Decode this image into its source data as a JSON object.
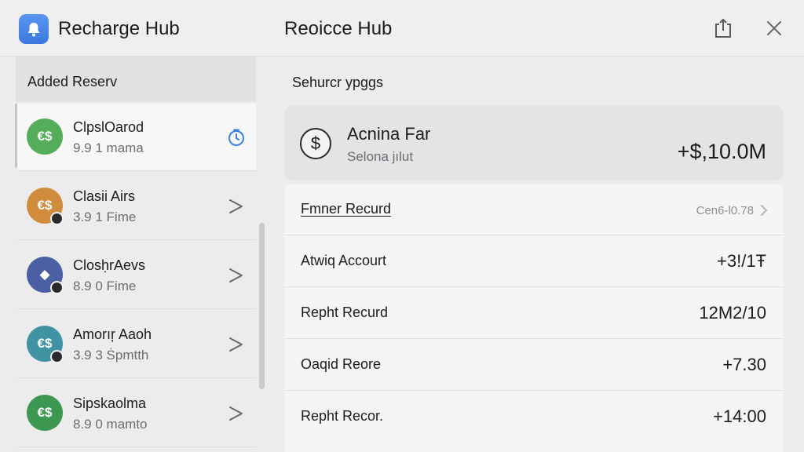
{
  "header": {
    "app_title": "Recharge Hub",
    "pane_title": "Reoicce Hub",
    "icons": {
      "app": "bell-icon",
      "share": "share-icon",
      "close": "close-icon"
    }
  },
  "sidebar": {
    "section_title": "Added Reserv",
    "items": [
      {
        "name": "ClpslOarod",
        "sub": "9.9 1 mama",
        "avatar_glyph": "€$",
        "avatar_color": "#55ad5a",
        "action_icon": "clock-icon",
        "selected": true,
        "badge": false
      },
      {
        "name": "Clasii Airs",
        "sub": "3.9 1 Fime",
        "avatar_glyph": "€$",
        "avatar_color": "#d08c3c",
        "action_icon": "chevron-right-icon",
        "selected": false,
        "badge": true
      },
      {
        "name": "ClosḥrAevs",
        "sub": "8.9 0 Fime",
        "avatar_glyph": "◆",
        "avatar_color": "#4a5fa4",
        "action_icon": "chevron-right-icon",
        "selected": false,
        "badge": true
      },
      {
        "name": "Amorıŗ Aaoh",
        "sub": "3.9 3 Ṡpmtth",
        "avatar_glyph": "€$",
        "avatar_color": "#3f93a3",
        "action_icon": "chevron-right-icon",
        "selected": false,
        "badge": true
      },
      {
        "name": "Sipskaolma",
        "sub": "8.9 0 mamto",
        "avatar_glyph": "€$",
        "avatar_color": "#3c9850",
        "action_icon": "chevron-right-icon",
        "selected": false,
        "badge": false
      }
    ]
  },
  "main": {
    "section_label": "Sehurcr ypggs",
    "summary": {
      "coin_glyph": "$",
      "name": "Acnina Far",
      "sub": "Selona jılut",
      "amount": "+$,10.0M"
    },
    "rows": [
      {
        "label": "Fmner Recurd",
        "value": "Cen6-l0.78",
        "link": true,
        "muted": true,
        "chevron": true
      },
      {
        "label": "Atwiq Accourt",
        "value": "+3!/1Ŧ",
        "link": false,
        "muted": false,
        "chevron": false
      },
      {
        "label": "Repht Recurd",
        "value": "12M2/10",
        "link": false,
        "muted": false,
        "chevron": false
      },
      {
        "label": "Oaqid Reore",
        "value": "+7.30",
        "link": false,
        "muted": false,
        "chevron": false
      },
      {
        "label": "Repht Recor.",
        "value": "+14:00",
        "link": false,
        "muted": false,
        "chevron": false
      }
    ]
  },
  "colors": {
    "accent": "#3a78e0",
    "clock": "#3b82e0"
  }
}
